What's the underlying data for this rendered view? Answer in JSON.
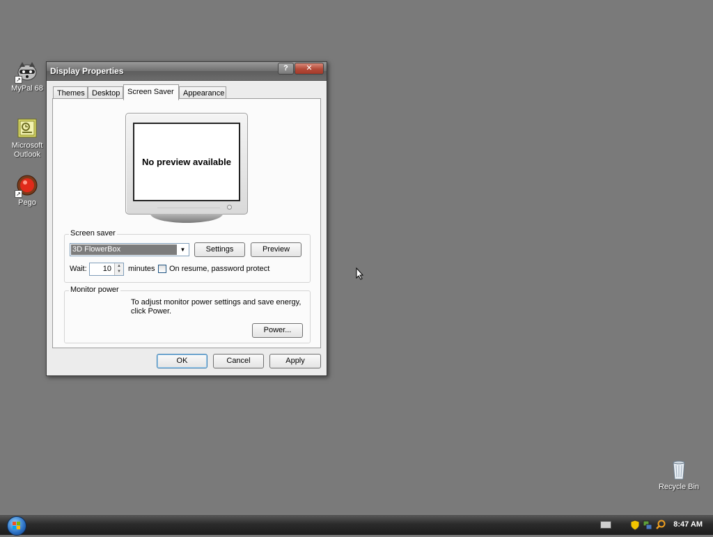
{
  "desktop": {
    "icons": [
      {
        "label": "MyPal 68",
        "icon": "raccoon-icon"
      },
      {
        "label": "Microsoft Outlook",
        "icon": "outlook-icon"
      },
      {
        "label": "Pego",
        "icon": "pego-icon"
      },
      {
        "label": "Recycle Bin",
        "icon": "recycle-bin-icon"
      }
    ]
  },
  "window": {
    "title": "Display Properties",
    "help_glyph": "?",
    "close_glyph": "✕",
    "tabs": [
      {
        "label": "Themes",
        "active": false
      },
      {
        "label": "Desktop",
        "active": false
      },
      {
        "label": "Screen Saver",
        "active": true
      },
      {
        "label": "Appearance",
        "active": false
      }
    ],
    "preview_text": "No preview available",
    "screen_saver": {
      "group_label": "Screen saver",
      "selected": "3D FlowerBox",
      "settings_label": "Settings",
      "preview_label": "Preview",
      "wait_label": "Wait:",
      "wait_value": "10",
      "minutes_label": "minutes",
      "password_label": "On resume, password protect",
      "password_checked": false
    },
    "monitor_power": {
      "group_label": "Monitor power",
      "description": "To adjust monitor power settings and save energy, click Power.",
      "power_label": "Power..."
    },
    "buttons": {
      "ok": "OK",
      "cancel": "Cancel",
      "apply": "Apply"
    }
  },
  "taskbar": {
    "clock": "8:47 AM"
  },
  "colors": {
    "desktop": "#7a7a7a",
    "selection": "#7c7c7c",
    "close_button": "#b34a38"
  }
}
